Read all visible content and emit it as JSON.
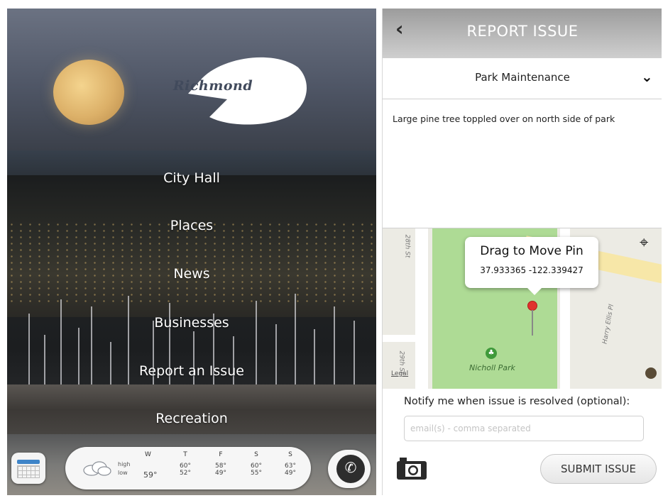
{
  "home": {
    "logo_text": "Richmond",
    "menu": [
      {
        "label": "City Hall"
      },
      {
        "label": "Places"
      },
      {
        "label": "News"
      },
      {
        "label": "Businesses"
      },
      {
        "label": "Report an Issue"
      },
      {
        "label": "Recreation"
      }
    ],
    "weather": {
      "high_label": "high",
      "low_label": "low",
      "days": [
        {
          "day": "W",
          "high": "59°",
          "low": ""
        },
        {
          "day": "T",
          "high": "60°",
          "low": "52°"
        },
        {
          "day": "F",
          "high": "58°",
          "low": "49°"
        },
        {
          "day": "S",
          "high": "60°",
          "low": "55°"
        },
        {
          "day": "S",
          "high": "63°",
          "low": "49°"
        }
      ]
    },
    "icons": {
      "calendar": "calendar-icon",
      "weather": "cloudy-icon",
      "phone": "phone-icon"
    }
  },
  "report": {
    "title": "REPORT ISSUE",
    "back_glyph": "‹",
    "category": "Park Maintenance",
    "description": "Large pine tree toppled over on north side of park",
    "map": {
      "callout_title": "Drag to Move Pin",
      "coordinates": "37.933365 -122.339427",
      "park_name": "Nicholl Park",
      "legal": "Legal",
      "streets": [
        "28th St",
        "29th St",
        "Harry Ellis Pl"
      ]
    },
    "notify_label": "Notify me when issue is resolved (optional):",
    "email_placeholder": "email(s) - comma separated",
    "submit_label": "SUBMIT ISSUE"
  }
}
